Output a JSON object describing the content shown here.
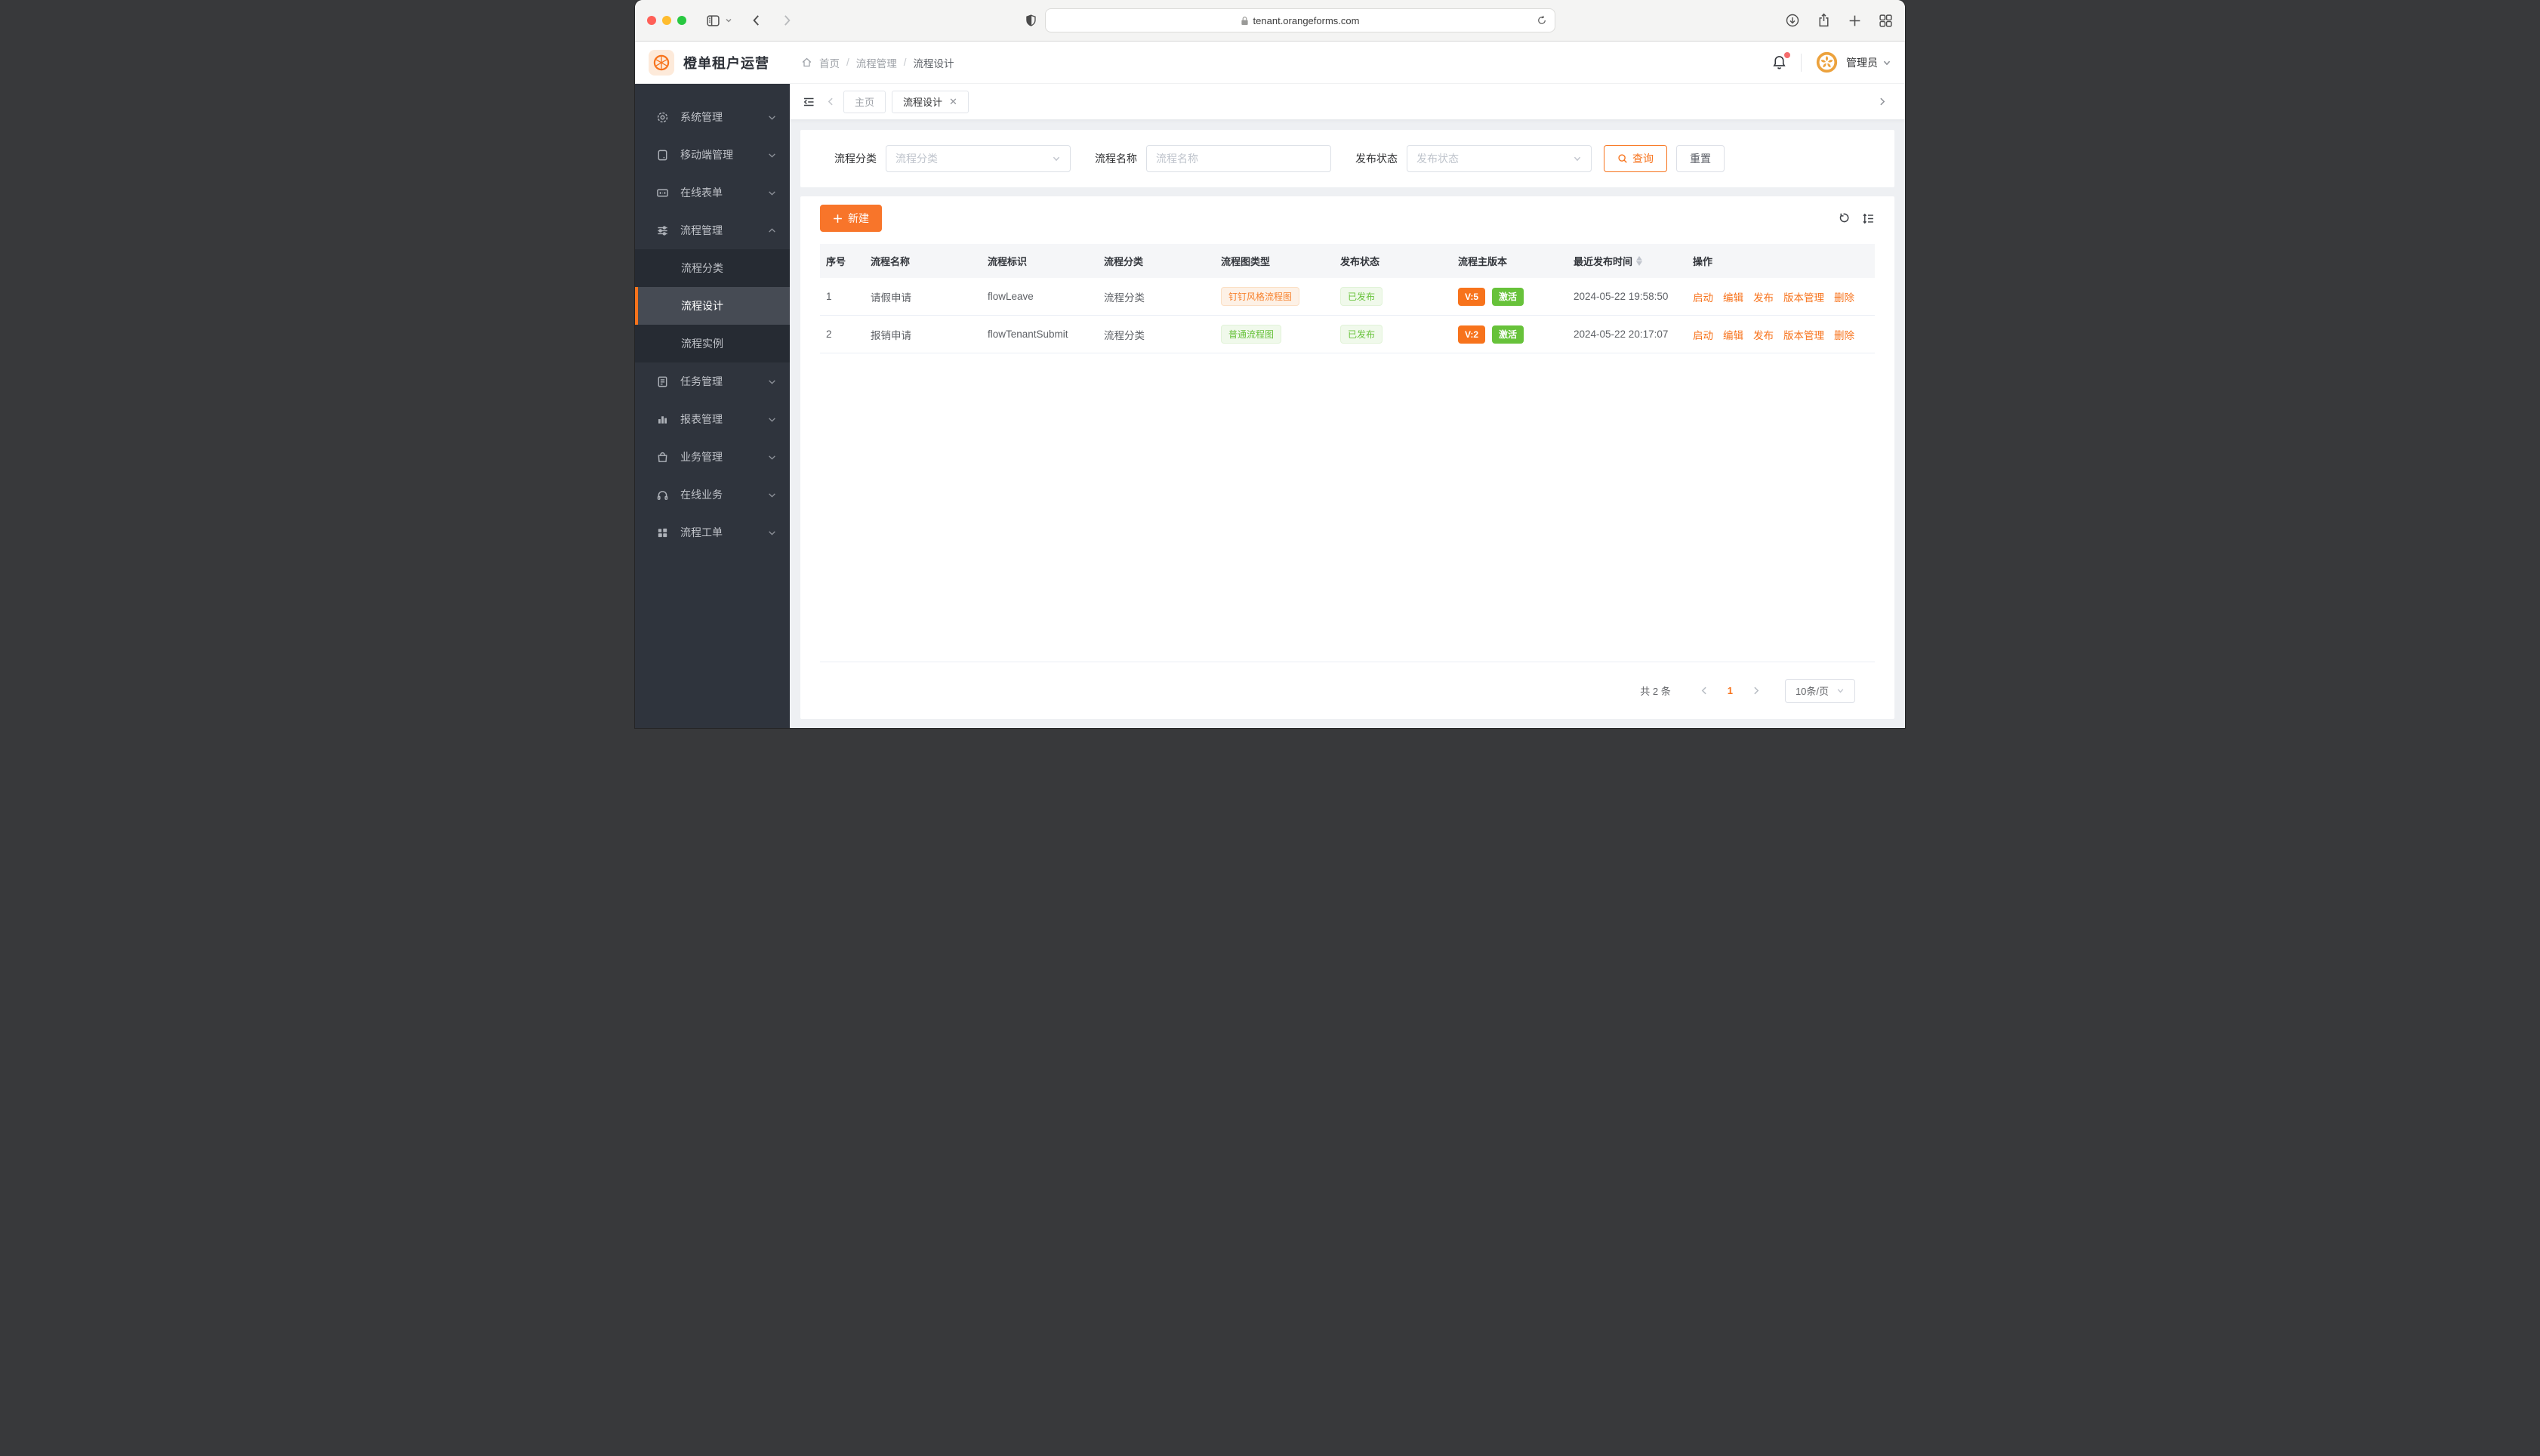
{
  "browser": {
    "url": "tenant.orangeforms.com"
  },
  "app": {
    "title": "橙单租户运营",
    "breadcrumb": [
      "首页",
      "流程管理",
      "流程设计"
    ],
    "user": "管理员"
  },
  "sidebar": {
    "items": [
      {
        "label": "系统管理",
        "icon": "gear"
      },
      {
        "label": "移动端管理",
        "icon": "mobile"
      },
      {
        "label": "在线表单",
        "icon": "form"
      },
      {
        "label": "流程管理",
        "icon": "sliders",
        "expanded": true
      },
      {
        "label": "任务管理",
        "icon": "tasks"
      },
      {
        "label": "报表管理",
        "icon": "chart"
      },
      {
        "label": "业务管理",
        "icon": "bag"
      },
      {
        "label": "在线业务",
        "icon": "headset"
      },
      {
        "label": "流程工单",
        "icon": "grid"
      }
    ],
    "submenu": [
      {
        "label": "流程分类",
        "active": false
      },
      {
        "label": "流程设计",
        "active": true
      },
      {
        "label": "流程实例",
        "active": false
      }
    ]
  },
  "tabs": {
    "home": "主页",
    "active": "流程设计"
  },
  "filters": {
    "category_label": "流程分类",
    "category_placeholder": "流程分类",
    "name_label": "流程名称",
    "name_placeholder": "流程名称",
    "status_label": "发布状态",
    "status_placeholder": "发布状态",
    "search": "查询",
    "reset": "重置"
  },
  "toolbar": {
    "create": "新建"
  },
  "table": {
    "headers": [
      "序号",
      "流程名称",
      "流程标识",
      "流程分类",
      "流程图类型",
      "发布状态",
      "流程主版本",
      "最近发布时间",
      "操作"
    ],
    "rows": [
      {
        "index": "1",
        "name": "请假申请",
        "key": "flowLeave",
        "category": "流程分类",
        "flow_type": {
          "label": "钉钉风格流程图",
          "variant": "orange"
        },
        "status": "已发布",
        "version": "V:5",
        "active": "激活",
        "published_at": "2024-05-22 19:58:50"
      },
      {
        "index": "2",
        "name": "报销申请",
        "key": "flowTenantSubmit",
        "category": "流程分类",
        "flow_type": {
          "label": "普通流程图",
          "variant": "green"
        },
        "status": "已发布",
        "version": "V:2",
        "active": "激活",
        "published_at": "2024-05-22 20:17:07"
      }
    ],
    "actions": [
      "启动",
      "编辑",
      "发布",
      "版本管理",
      "删除"
    ]
  },
  "pagination": {
    "total": "共 2 条",
    "page": "1",
    "page_size": "10条/页"
  },
  "colors": {
    "accent": "#f7731c",
    "success": "#67c23a",
    "badge": "#f56c6c",
    "sidebar": "#2f343d"
  }
}
